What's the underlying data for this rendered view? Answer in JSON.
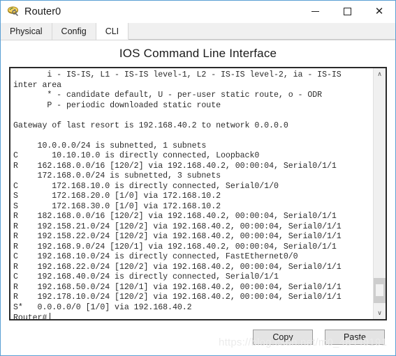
{
  "window": {
    "title": "Router0",
    "icon": "router-icon",
    "controls": {
      "minimize_label": "—",
      "maximize_label": "□",
      "close_label": "✕"
    },
    "accent_border": "#5a9fd4"
  },
  "tabs": [
    {
      "id": "physical",
      "label": "Physical",
      "active": false
    },
    {
      "id": "config",
      "label": "Config",
      "active": false
    },
    {
      "id": "cli",
      "label": "CLI",
      "active": true
    }
  ],
  "pane": {
    "title": "IOS Command Line Interface"
  },
  "terminal": {
    "lines": [
      "       i - IS-IS, L1 - IS-IS level-1, L2 - IS-IS level-2, ia - IS-IS",
      "inter area",
      "       * - candidate default, U - per-user static route, o - ODR",
      "       P - periodic downloaded static route",
      "",
      "Gateway of last resort is 192.168.40.2 to network 0.0.0.0",
      "",
      "     10.0.0.0/24 is subnetted, 1 subnets",
      "C       10.10.10.0 is directly connected, Loopback0",
      "R    162.168.0.0/16 [120/2] via 192.168.40.2, 00:00:04, Serial0/1/1",
      "     172.168.0.0/24 is subnetted, 3 subnets",
      "C       172.168.10.0 is directly connected, Serial0/1/0",
      "S       172.168.20.0 [1/0] via 172.168.10.2",
      "S       172.168.30.0 [1/0] via 172.168.10.2",
      "R    182.168.0.0/16 [120/2] via 192.168.40.2, 00:00:04, Serial0/1/1",
      "R    192.158.21.0/24 [120/2] via 192.168.40.2, 00:00:04, Serial0/1/1",
      "R    192.158.22.0/24 [120/2] via 192.168.40.2, 00:00:04, Serial0/1/1",
      "R    192.168.9.0/24 [120/1] via 192.168.40.2, 00:00:04, Serial0/1/1",
      "C    192.168.10.0/24 is directly connected, FastEthernet0/0",
      "R    192.168.22.0/24 [120/2] via 192.168.40.2, 00:00:04, Serial0/1/1",
      "C    192.168.40.0/24 is directly connected, Serial0/1/1",
      "R    192.168.50.0/24 [120/1] via 192.168.40.2, 00:00:04, Serial0/1/1",
      "R    192.178.10.0/24 [120/2] via 192.168.40.2, 00:00:04, Serial0/1/1",
      "S*   0.0.0.0/0 [1/0] via 192.168.40.2"
    ],
    "prompt": "Router#",
    "scrollbar": {
      "up_arrow": "∧",
      "down_arrow": "∨",
      "thumb_position": "near-bottom"
    }
  },
  "actions": {
    "copy_label": "Copy",
    "paste_label": "Paste"
  },
  "watermark": {
    "text": "https://blog.csdn.net/m0_48449191"
  }
}
